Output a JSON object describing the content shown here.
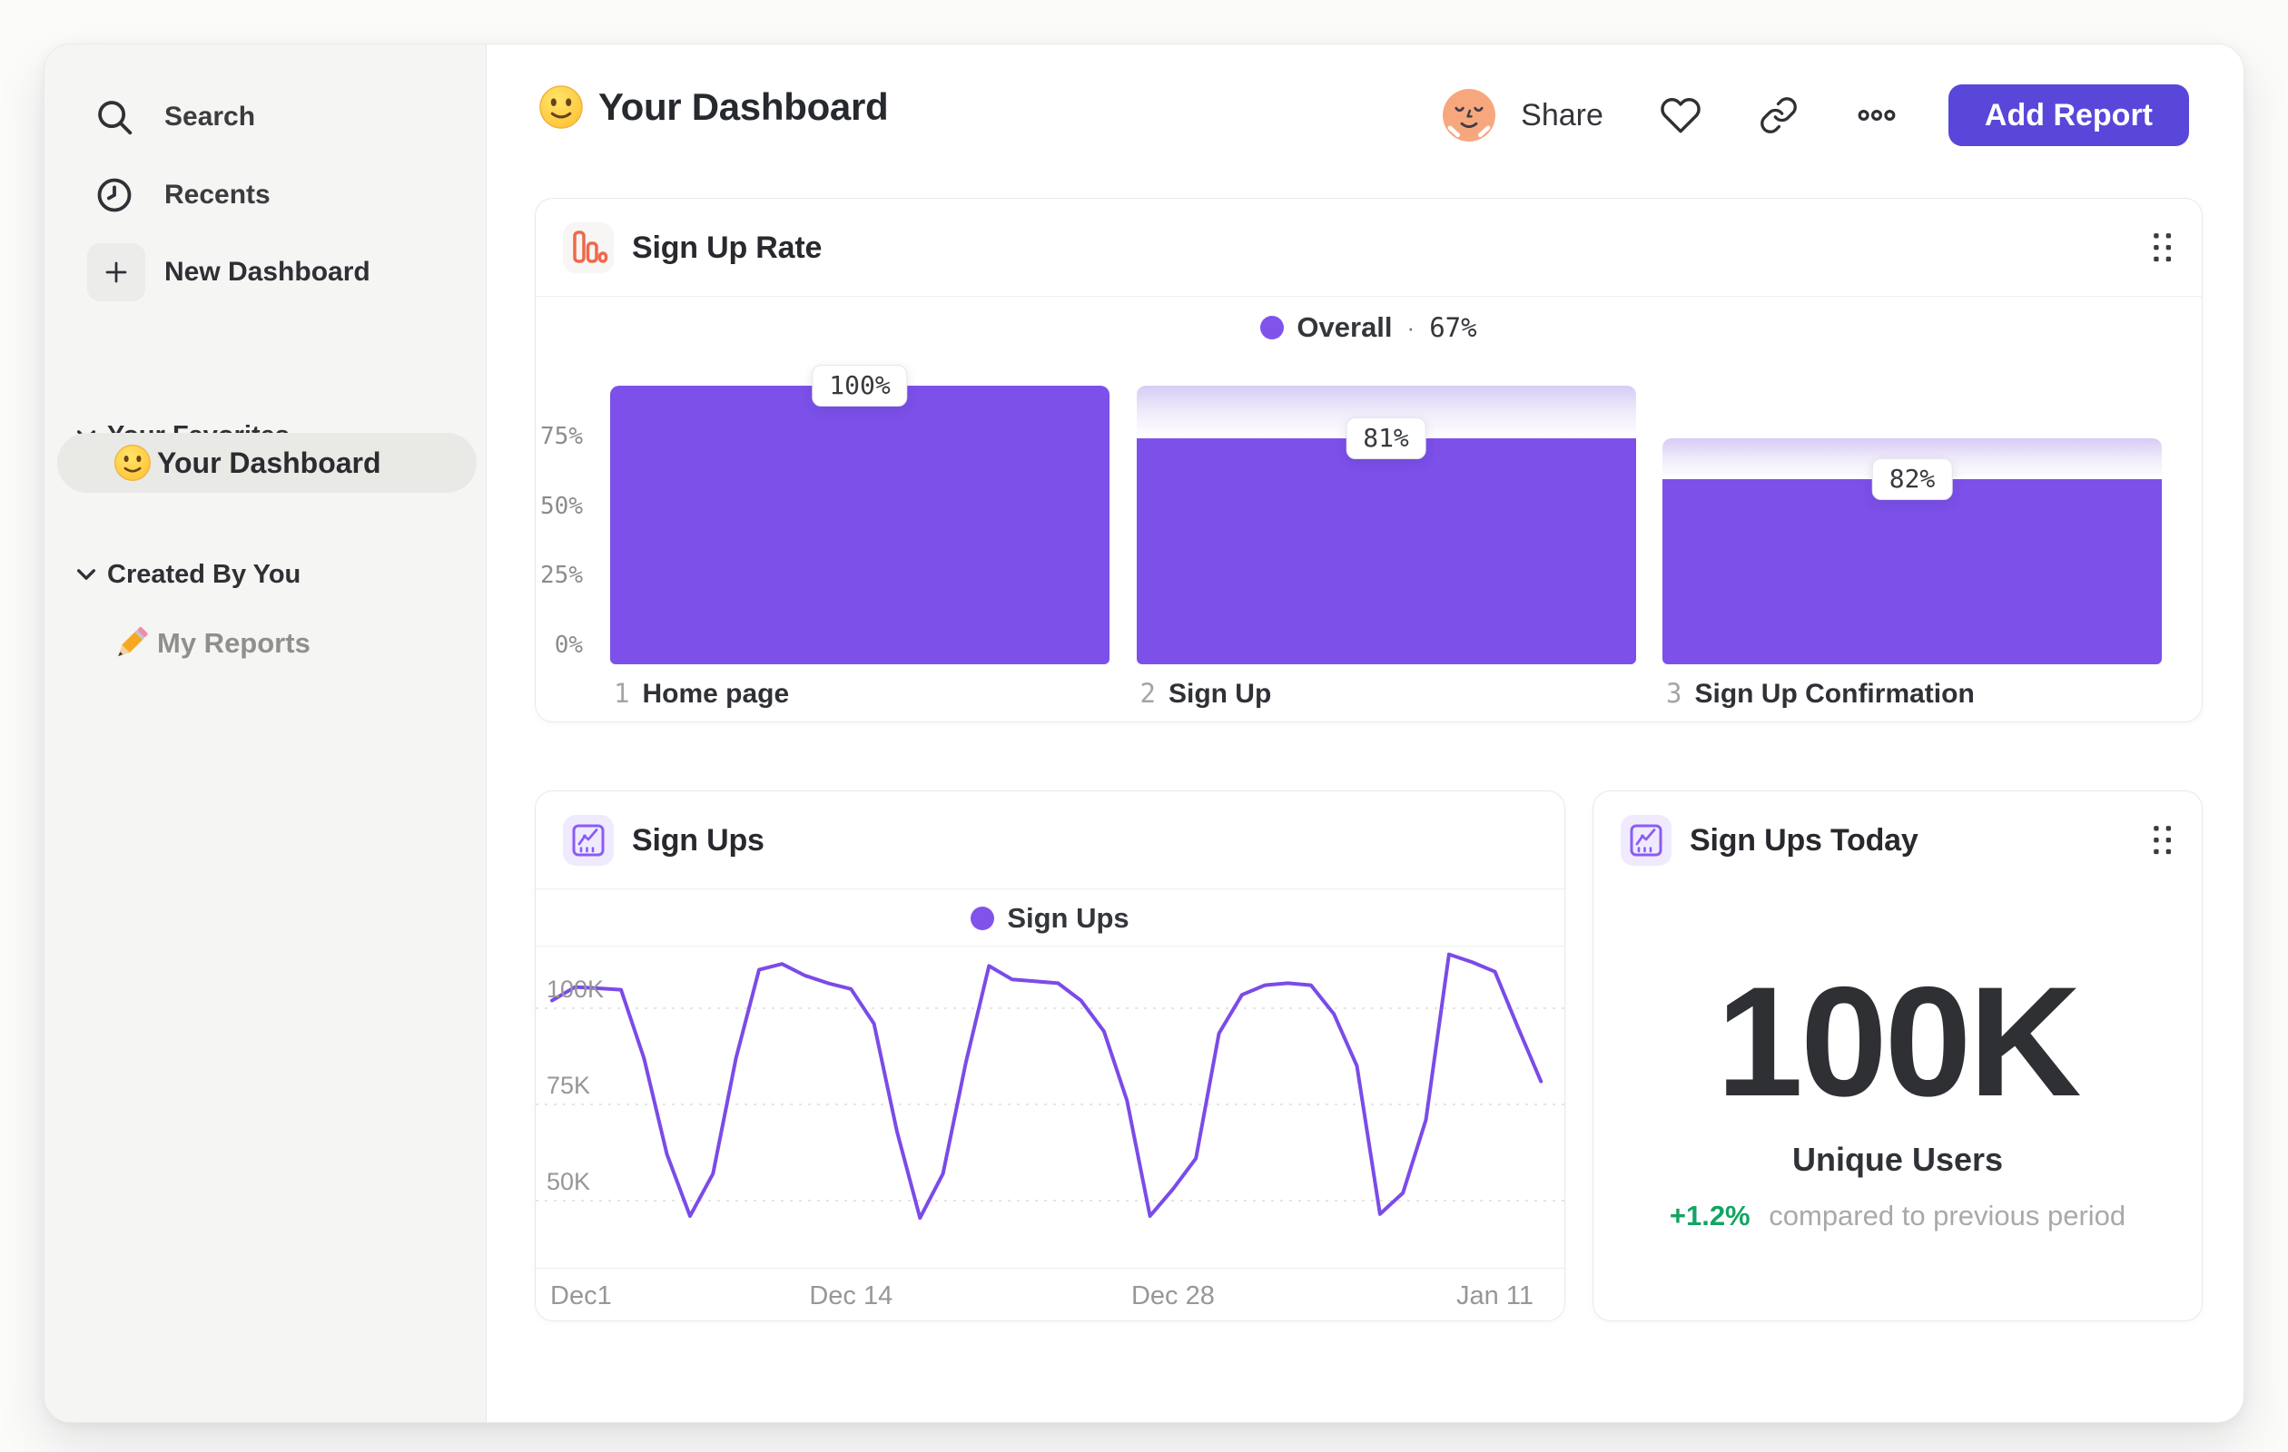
{
  "sidebar": {
    "search": "Search",
    "recents": "Recents",
    "new_dashboard": "New Dashboard",
    "favorites_section": "Your Favorites",
    "favorite_item": "Your Dashboard",
    "created_section": "Created By You",
    "reports_item": "My Reports"
  },
  "header": {
    "title": "Your Dashboard",
    "share_label": "Share",
    "add_report_label": "Add Report"
  },
  "cards": {
    "funnel": {
      "title": "Sign Up Rate",
      "legend_label": "Overall",
      "legend_sep": "·",
      "legend_value": "67%"
    },
    "line": {
      "title": "Sign Ups",
      "legend_label": "Sign Ups"
    },
    "today": {
      "title": "Sign Ups Today",
      "value": "100K",
      "label": "Unique Users",
      "delta": "+1.2%",
      "delta_note": "compared to previous period"
    }
  },
  "colors": {
    "bar_purple": "#7C50E9",
    "line_purple": "#7B4BE8",
    "legend_dot": "#8153EB",
    "button_purple": "#5847D9",
    "icon_coral": "#F0684C",
    "icon_purple": "#8A5CF5",
    "delta_green": "#13A463"
  },
  "chart_data": [
    {
      "type": "bar",
      "subtype": "funnel",
      "title": "Sign Up Rate",
      "legend": [
        {
          "label": "Overall",
          "value": "67%"
        }
      ],
      "steps": [
        {
          "index": 1,
          "label": "Home page",
          "conversion_from_previous_pct": 100,
          "cumulative_pct": 100
        },
        {
          "index": 2,
          "label": "Sign Up",
          "conversion_from_previous_pct": 81,
          "cumulative_pct": 81
        },
        {
          "index": 3,
          "label": "Sign Up Confirmation",
          "conversion_from_previous_pct": 82,
          "cumulative_pct": 66.4
        }
      ],
      "yticks": [
        {
          "label": "75%",
          "value": 75
        },
        {
          "label": "50%",
          "value": 50
        },
        {
          "label": "25%",
          "value": 25
        },
        {
          "label": "0%",
          "value": 0
        }
      ],
      "ylim": [
        0,
        100
      ],
      "grid": false,
      "legend_position": "top-center"
    },
    {
      "type": "line",
      "title": "Sign Ups",
      "series": [
        {
          "name": "Sign Ups",
          "unit": "K",
          "values": [
            102,
            105.5,
            105.2,
            104.8,
            87,
            62,
            46,
            57,
            87,
            110,
            111.5,
            108.5,
            106.5,
            105,
            96,
            68,
            45.5,
            57,
            86,
            111,
            107.5,
            107,
            106.5,
            102,
            94,
            76,
            46,
            53,
            61,
            93.5,
            103.5,
            106,
            106.5,
            106,
            98.5,
            85,
            46.5,
            52,
            71,
            114,
            112,
            109.5,
            95,
            81
          ]
        }
      ],
      "x_tick_labels": [
        {
          "label": "Dec1",
          "index": 0
        },
        {
          "label": "Dec 14",
          "index": 13
        },
        {
          "label": "Dec 28",
          "index": 27
        },
        {
          "label": "Jan 11",
          "index": 41
        }
      ],
      "yticks": [
        {
          "label": "100K",
          "value": 100
        },
        {
          "label": "75K",
          "value": 75
        },
        {
          "label": "50K",
          "value": 50
        }
      ],
      "ylim": [
        40,
        117
      ],
      "grid": "dashed",
      "legend_position": "top-center"
    }
  ]
}
